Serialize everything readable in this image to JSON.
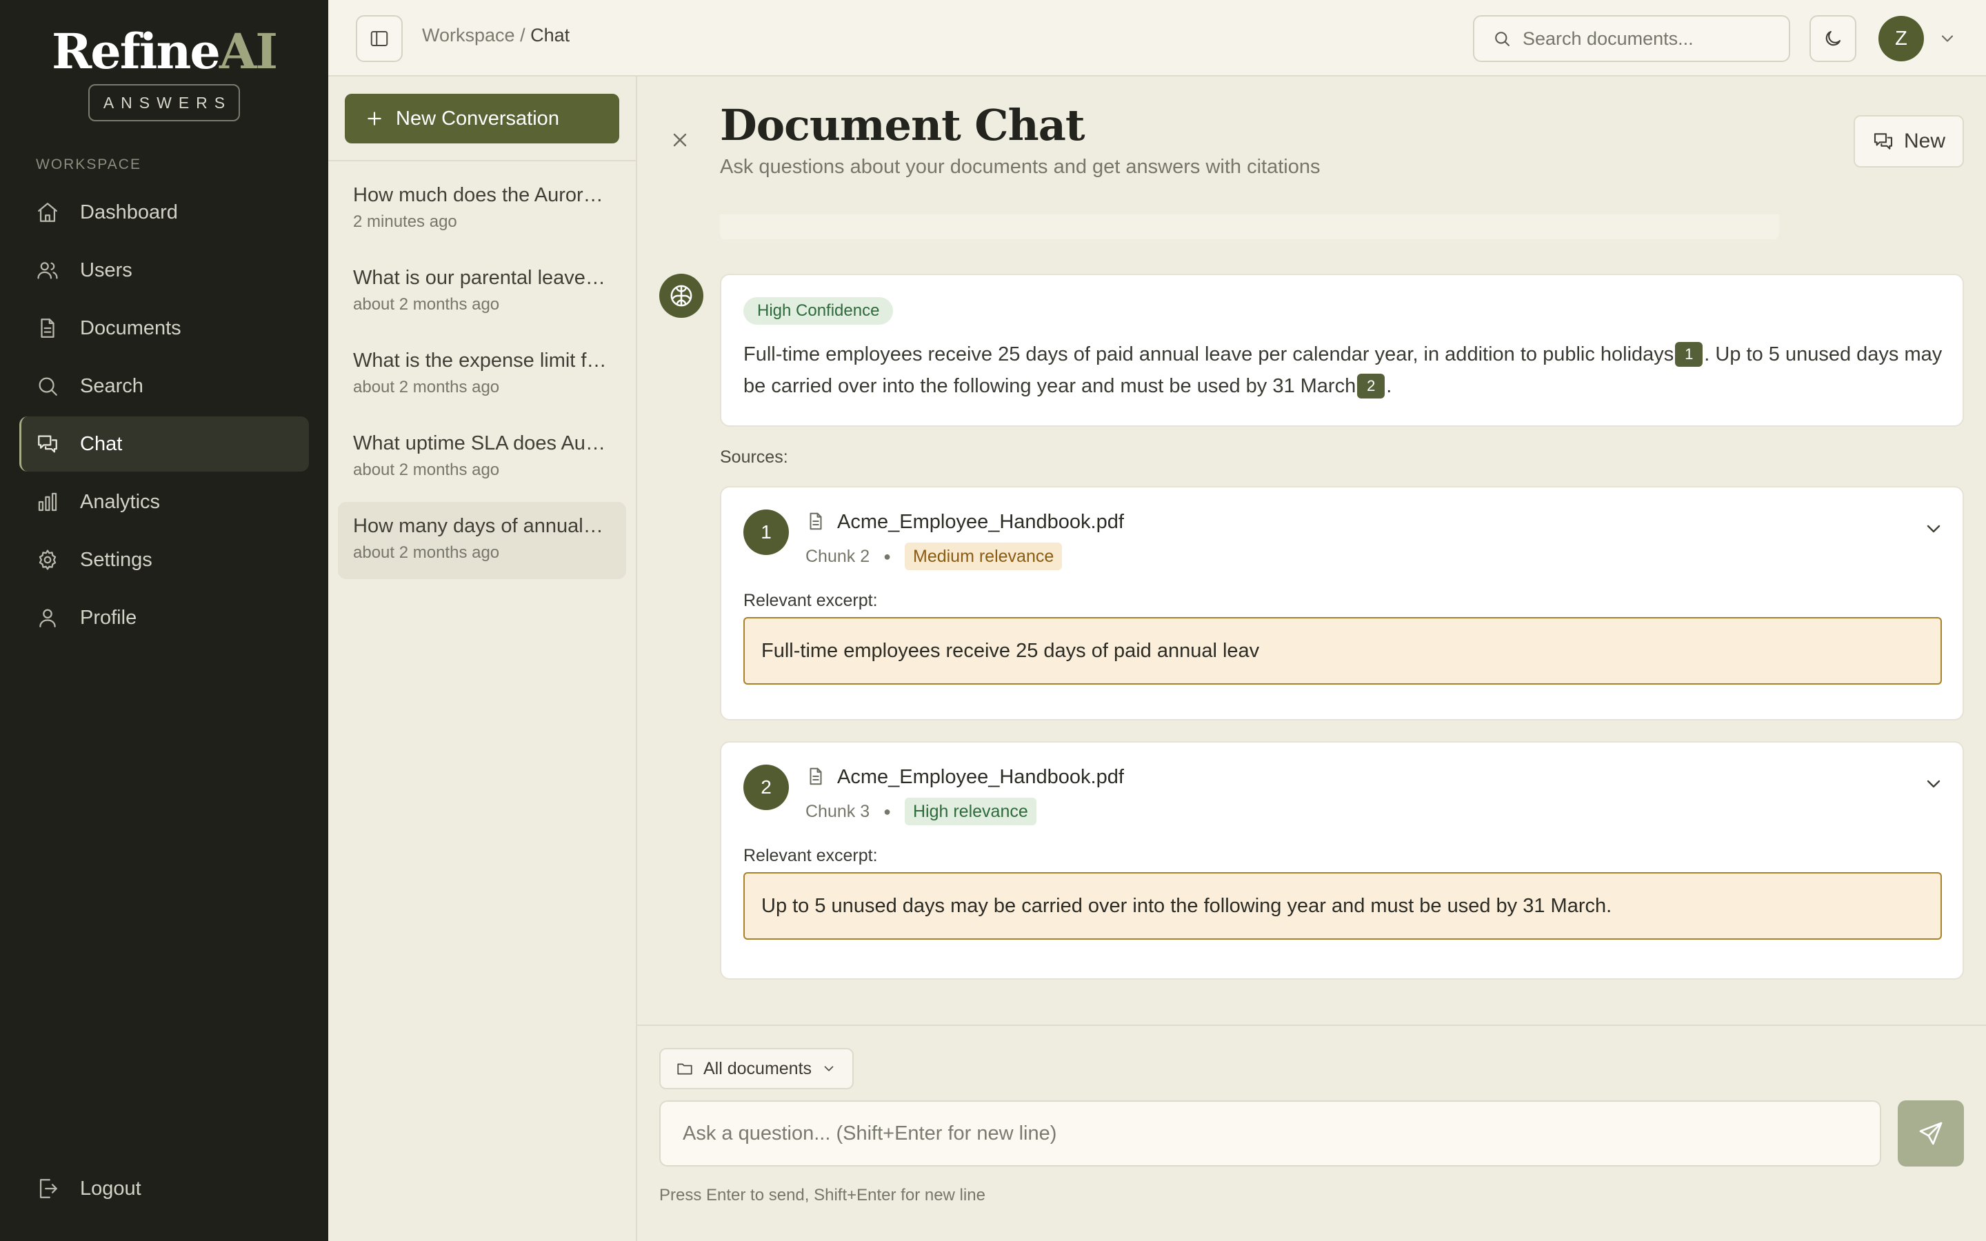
{
  "brand": {
    "name_main": "Refine",
    "name_accent": "AI",
    "tagline": "ANSWERS"
  },
  "sidebar": {
    "section_label": "WORKSPACE",
    "items": [
      {
        "label": "Dashboard",
        "icon": "home-icon"
      },
      {
        "label": "Users",
        "icon": "users-icon"
      },
      {
        "label": "Documents",
        "icon": "document-icon"
      },
      {
        "label": "Search",
        "icon": "search-icon"
      },
      {
        "label": "Chat",
        "icon": "chat-icon",
        "active": true
      },
      {
        "label": "Analytics",
        "icon": "bar-chart-icon"
      },
      {
        "label": "Settings",
        "icon": "gear-icon"
      },
      {
        "label": "Profile",
        "icon": "user-icon"
      }
    ],
    "logout_label": "Logout"
  },
  "header": {
    "breadcrumb_root": "Workspace",
    "breadcrumb_sep": "/",
    "breadcrumb_current": "Chat",
    "search_placeholder": "Search documents...",
    "avatar_initial": "Z"
  },
  "conversations": {
    "new_label": "New Conversation",
    "items": [
      {
        "title": "How much does the Aurora Enterprise plan cost?",
        "time": "2 minutes ago"
      },
      {
        "title": "What is our parental leave policy?",
        "time": "about 2 months ago"
      },
      {
        "title": "What is the expense limit for travel?",
        "time": "about 2 months ago"
      },
      {
        "title": "What uptime SLA does Aurora offer?",
        "time": "about 2 months ago"
      },
      {
        "title": "How many days of annual leave do employees get?",
        "time": "about 2 months ago",
        "active": true
      }
    ]
  },
  "main": {
    "title": "Document Chat",
    "subtitle": "Ask questions about your documents and get answers with citations",
    "new_button": "New",
    "answer": {
      "confidence": "High Confidence",
      "part1": "Full-time employees receive 25 days of paid annual leave per calendar year, in addition to public holidays",
      "cite1": "1",
      "part2": ". Up to 5 unused days may be carried over into the following year and must be used by 31 March",
      "cite2": "2",
      "part3": "."
    },
    "sources_label": "Sources:",
    "sources": [
      {
        "num": "1",
        "file": "Acme_Employee_Handbook.pdf",
        "chunk": "Chunk 2",
        "relevance": "Medium relevance",
        "excerpt_label": "Relevant excerpt:",
        "excerpt": "Full-time employees receive 25 days of paid annual leav"
      },
      {
        "num": "2",
        "file": "Acme_Employee_Handbook.pdf",
        "chunk": "Chunk 3",
        "relevance": "High relevance",
        "excerpt_label": "Relevant excerpt:",
        "excerpt": "Up to 5 unused days may be carried over into the following year and must be used by 31 March."
      }
    ]
  },
  "composer": {
    "scope": "All documents",
    "placeholder": "Ask a question... (Shift+Enter for new line)",
    "hint": "Press Enter to send, Shift+Enter for new line"
  },
  "colors": {
    "sidebar_bg": "#1f201a",
    "accent_olive": "#5a6334",
    "logo_accent": "#9ea57f",
    "page_bg": "#efece0",
    "excerpt_bg": "#fbeedb",
    "excerpt_border": "#a8822a",
    "high_badge_bg": "#e2eedf",
    "medium_badge_bg": "#f8ead0"
  }
}
